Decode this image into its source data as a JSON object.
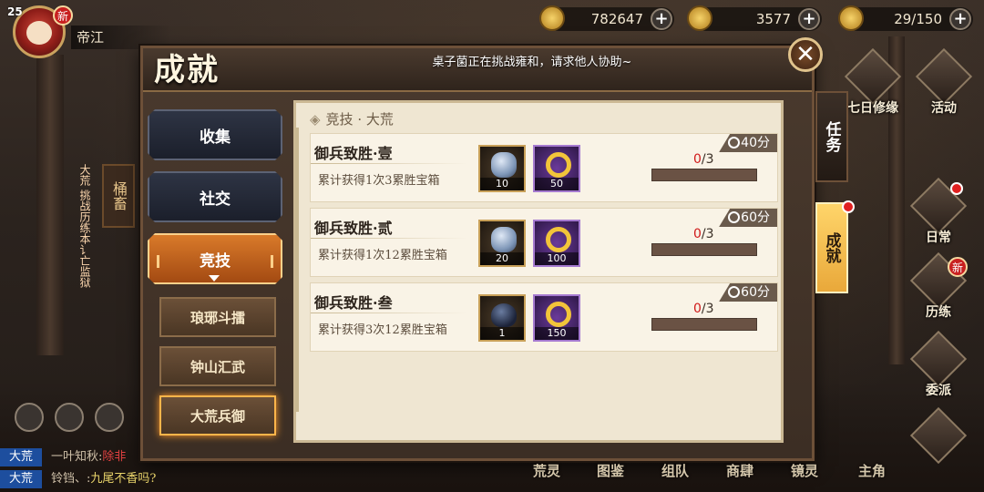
{
  "top": {
    "level": "25",
    "player_name": "帝江",
    "new_label": "新",
    "currency_1": "782647",
    "currency_2": "3577",
    "stamina": "29/150"
  },
  "panel": {
    "title": "成就",
    "notice": "桌子菌正在挑战雍和，请求他人协助~",
    "close_glyph": "✕"
  },
  "nav": {
    "collect": "收集",
    "social": "社交",
    "arena": "竞技",
    "sub": [
      "琅琊斗擂",
      "钟山汇武",
      "大荒兵御"
    ]
  },
  "section": {
    "title": "竞技 · 大荒"
  },
  "achievements": [
    {
      "title": "御兵致胜·壹",
      "desc": "累计获得1次3累胜宝箱",
      "points": "40分",
      "reward1": "10",
      "reward2": "50",
      "progress_cur": "0",
      "progress_total": "/3",
      "progress_fraction": 0
    },
    {
      "title": "御兵致胜·贰",
      "desc": "累计获得1次12累胜宝箱",
      "points": "60分",
      "reward1": "20",
      "reward2": "100",
      "progress_cur": "0",
      "progress_total": "/3",
      "progress_fraction": 0
    },
    {
      "title": "御兵致胜·叁",
      "desc": "累计获得3次12累胜宝箱",
      "points": "60分",
      "reward1": "1",
      "reward2": "150",
      "progress_cur": "0",
      "progress_total": "/3",
      "progress_fraction": 0
    }
  ],
  "right_tabs": {
    "task": "任务",
    "achievement": "成就"
  },
  "hub": {
    "qiri": "七日修缘",
    "huodong": "活动",
    "richang": "日常",
    "lilian": "历练",
    "weipai": "委派"
  },
  "left_vertical": "大荒 挑战历练本讠亡监狱",
  "chat": [
    {
      "tag": "大荒",
      "user": "一叶知秋:",
      "msg": "除非",
      "color": "red"
    },
    {
      "tag": "大荒",
      "user": "铃铛、:",
      "msg": "九尾不香吗?",
      "color": "yellow"
    }
  ],
  "bottom_nav": [
    "荒灵",
    "图鉴",
    "组队",
    "商肆",
    "镜灵",
    "主角"
  ],
  "colors": {
    "accent": "#d97a2a",
    "progress_red": "#d01818",
    "chat_tag": "#1d4e9e"
  }
}
